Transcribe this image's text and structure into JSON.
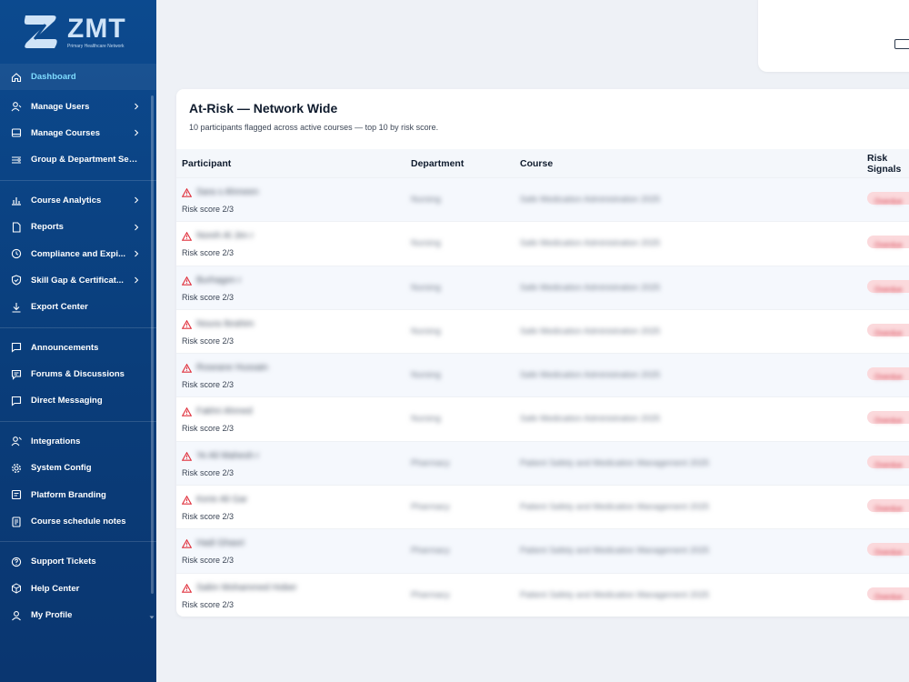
{
  "brand": {
    "name": "ZMT",
    "subtitle": "Primary Healthcare Network"
  },
  "sidebar": {
    "items": [
      {
        "label": "Dashboard",
        "icon": "home-icon",
        "active": true,
        "chevron": false
      },
      {
        "label": "Manage Users",
        "icon": "user-icon",
        "chevron": true
      },
      {
        "label": "Manage Courses",
        "icon": "book-icon",
        "chevron": true
      },
      {
        "label": "Group & Department Setup",
        "icon": "list-settings-icon",
        "chevron": false
      },
      {
        "label": "Course Analytics",
        "icon": "bar-chart-icon",
        "chevron": true
      },
      {
        "label": "Reports",
        "icon": "document-icon",
        "chevron": true
      },
      {
        "label": "Compliance and Expi...",
        "icon": "clock-icon",
        "chevron": true
      },
      {
        "label": "Skill Gap & Certificat...",
        "icon": "shield-check-icon",
        "chevron": true
      },
      {
        "label": "Export Center",
        "icon": "download-icon",
        "chevron": false
      },
      {
        "label": "Announcements",
        "icon": "message-square-icon",
        "chevron": false
      },
      {
        "label": "Forums & Discussions",
        "icon": "forum-icon",
        "chevron": false
      },
      {
        "label": "Direct Messaging",
        "icon": "chat-icon",
        "chevron": false
      },
      {
        "label": "Integrations",
        "icon": "user-link-icon",
        "chevron": false
      },
      {
        "label": "System Config",
        "icon": "gear-icon",
        "chevron": false
      },
      {
        "label": "Platform Branding",
        "icon": "branding-icon",
        "chevron": false
      },
      {
        "label": "Course schedule notes",
        "icon": "notes-icon",
        "chevron": false
      },
      {
        "label": "Support Tickets",
        "icon": "help-circle-icon",
        "chevron": false
      },
      {
        "label": "Help Center",
        "icon": "box-icon",
        "chevron": false
      },
      {
        "label": "My Profile",
        "icon": "profile-icon",
        "chevron": false
      }
    ]
  },
  "panel": {
    "title": "At-Risk — Network Wide",
    "subtitle": "10 participants flagged across active courses — top 10 by risk score.",
    "columns": [
      "Participant",
      "Department",
      "Course",
      "Risk Signals"
    ],
    "rows": [
      {
        "name": "Sara s Ahmeen",
        "score": "Risk score 2/3",
        "department": "Nursing",
        "course": "Safe Medication Administration 2025",
        "signal": "Overdue"
      },
      {
        "name": "Noreh Al Jim r",
        "score": "Risk score 2/3",
        "department": "Nursing",
        "course": "Safe Medication Administration 2025",
        "signal": "Overdue"
      },
      {
        "name": "Burhagen r",
        "score": "Risk score 2/3",
        "department": "Nursing",
        "course": "Safe Medication Administration 2025",
        "signal": "Overdue"
      },
      {
        "name": "Noura Ibrahim",
        "score": "Risk score 2/3",
        "department": "Nursing",
        "course": "Safe Medication Administration 2025",
        "signal": "Overdue"
      },
      {
        "name": "Roseane Hussain",
        "score": "Risk score 2/3",
        "department": "Nursing",
        "course": "Safe Medication Administration 2025",
        "signal": "Overdue"
      },
      {
        "name": "Fakhri Ahmed",
        "score": "Risk score 2/3",
        "department": "Nursing",
        "course": "Safe Medication Administration 2025",
        "signal": "Overdue"
      },
      {
        "name": "Ye Ali Mahesh r",
        "score": "Risk score 2/3",
        "department": "Pharmacy",
        "course": "Patient Safety and Medication Management 2025",
        "signal": "Overdue"
      },
      {
        "name": "Kerie Ali Gar",
        "score": "Risk score 2/3",
        "department": "Pharmacy",
        "course": "Patient Safety and Medication Management 2025",
        "signal": "Overdue"
      },
      {
        "name": "Hadi Ghasri",
        "score": "Risk score 2/3",
        "department": "Pharmacy",
        "course": "Patient Safety and Medication Management 2025",
        "signal": "Overdue"
      },
      {
        "name": "Salim Mohammed Hober",
        "score": "Risk score 2/3",
        "department": "Pharmacy",
        "course": "Patient Safety and Medication Management 2025",
        "signal": "Overdue"
      }
    ]
  },
  "colors": {
    "sidebar_top": "#0c4a8f",
    "sidebar_bottom": "#0a3670",
    "active_label": "#7fdcff",
    "warning": "#e0303c",
    "badge_bg": "#fbd9dc"
  }
}
